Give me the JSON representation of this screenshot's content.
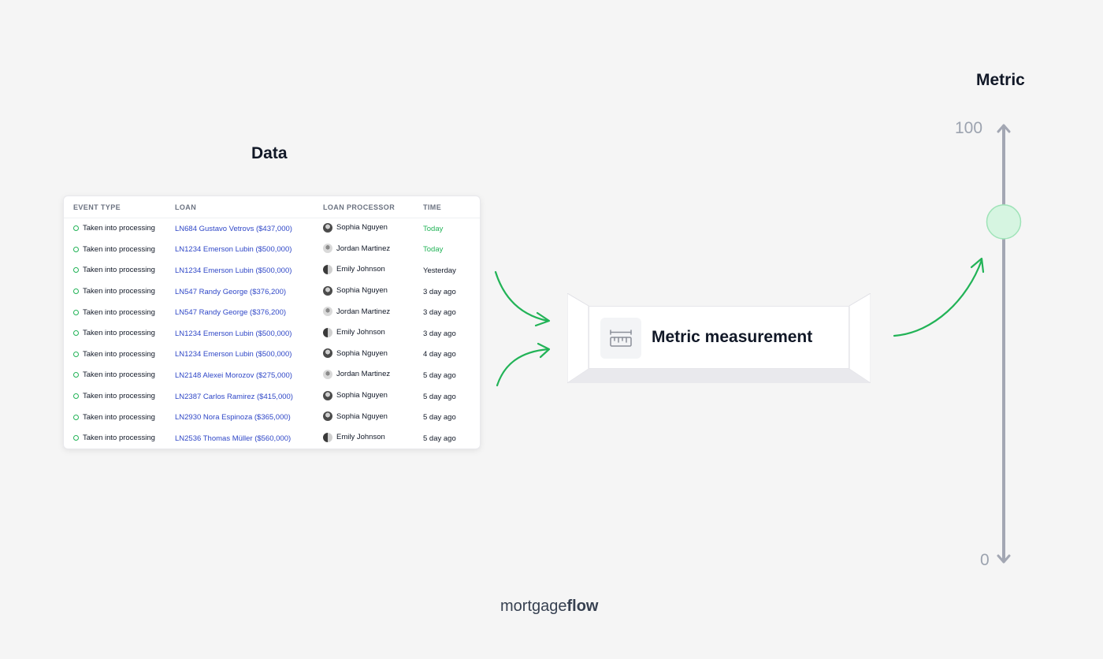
{
  "headings": {
    "data": "Data",
    "metric": "Metric"
  },
  "table": {
    "columns": [
      "EVENT TYPE",
      "LOAN",
      "LOAN PROCESSOR",
      "TIME"
    ],
    "rows": [
      {
        "event": "Taken into processing",
        "loan": "LN684 Gustavo Vetrovs ($437,000)",
        "processor": "Sophia Nguyen",
        "time": "Today"
      },
      {
        "event": "Taken into processing",
        "loan": "LN1234 Emerson Lubin ($500,000)",
        "processor": "Jordan Martinez",
        "time": "Today"
      },
      {
        "event": "Taken into processing",
        "loan": "LN1234 Emerson Lubin ($500,000)",
        "processor": "Emily Johnson",
        "time": "Yesterday"
      },
      {
        "event": "Taken into processing",
        "loan": "LN547 Randy George ($376,200)",
        "processor": "Sophia Nguyen",
        "time": "3 day ago"
      },
      {
        "event": "Taken into processing",
        "loan": "LN547 Randy George ($376,200)",
        "processor": "Jordan Martinez",
        "time": "3 day ago"
      },
      {
        "event": "Taken into processing",
        "loan": "LN1234 Emerson Lubin ($500,000)",
        "processor": "Emily Johnson",
        "time": "3 day ago"
      },
      {
        "event": "Taken into processing",
        "loan": "LN1234 Emerson Lubin ($500,000)",
        "processor": "Sophia Nguyen",
        "time": "4 day ago"
      },
      {
        "event": "Taken into processing",
        "loan": "LN2148 Alexei Morozov ($275,000)",
        "processor": "Jordan Martinez",
        "time": "5 day ago"
      },
      {
        "event": "Taken into processing",
        "loan": "LN2387 Carlos Ramirez ($415,000)",
        "processor": "Sophia Nguyen",
        "time": "5 day ago"
      },
      {
        "event": "Taken into processing",
        "loan": "LN2930 Nora Espinoza ($365,000)",
        "processor": "Sophia Nguyen",
        "time": "5 day ago"
      },
      {
        "event": "Taken into processing",
        "loan": "LN2536 Thomas Müller ($560,000)",
        "processor": "Emily Johnson",
        "time": "5 day ago"
      }
    ]
  },
  "measure": {
    "label": "Metric measurement",
    "icon": "ruler-icon"
  },
  "metric_axis": {
    "max_label": "100",
    "min_label": "0",
    "max": 100,
    "min": 0,
    "value": 78
  },
  "brand": {
    "prefix": "mortgage",
    "suffix": "flow"
  },
  "colors": {
    "accent": "#22b357",
    "link": "#2f47c7",
    "axis": "#a3a7b3",
    "knob_fill": "#d6f5e1",
    "knob_stroke": "#9fe3b8"
  }
}
